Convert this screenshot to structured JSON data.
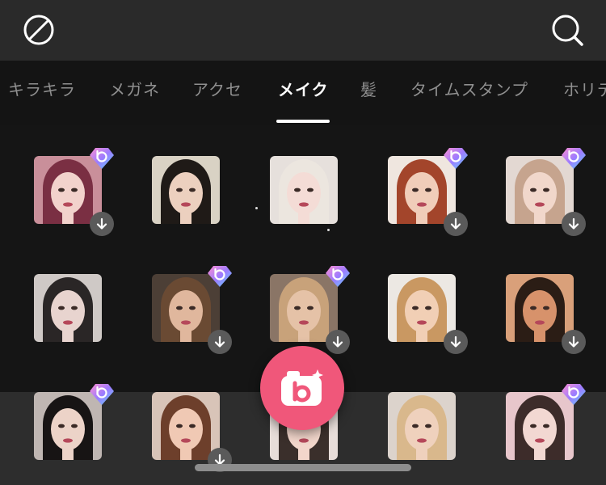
{
  "header": {
    "left_icon": "prohibit-icon",
    "right_icon": "search-icon"
  },
  "tabs": [
    {
      "label": "キラキラ"
    },
    {
      "label": "メガネ"
    },
    {
      "label": "アクセ"
    },
    {
      "label": "メイク",
      "active": true
    },
    {
      "label": "髪"
    },
    {
      "label": "タイムスタンプ"
    },
    {
      "label": "ホリデー"
    }
  ],
  "stickers": [
    {
      "row": 0,
      "col": 0,
      "premium": true,
      "download": true,
      "palette": {
        "bg": "#c98f9a",
        "hair": "#7a2f43",
        "skin": "#f2d2cc"
      }
    },
    {
      "row": 0,
      "col": 1,
      "premium": false,
      "download": false,
      "palette": {
        "bg": "#d9d2c4",
        "hair": "#1f1a17",
        "skin": "#ecd0bf"
      }
    },
    {
      "row": 0,
      "col": 2,
      "premium": false,
      "download": false,
      "palette": {
        "bg": "#e6e0dc",
        "hair": "#ece6df",
        "skin": "#f4dcd6"
      }
    },
    {
      "row": 0,
      "col": 3,
      "premium": true,
      "download": true,
      "palette": {
        "bg": "#efe6df",
        "hair": "#a3452b",
        "skin": "#f0cdb9"
      }
    },
    {
      "row": 0,
      "col": 4,
      "premium": true,
      "download": true,
      "palette": {
        "bg": "#e3d8d2",
        "hair": "#c6a48e",
        "skin": "#f1d7cb"
      }
    },
    {
      "row": 1,
      "col": 0,
      "premium": false,
      "download": false,
      "palette": {
        "bg": "#cfc9c6",
        "hair": "#2a2626",
        "skin": "#e8d4cf"
      }
    },
    {
      "row": 1,
      "col": 1,
      "premium": true,
      "download": true,
      "palette": {
        "bg": "#4c3f36",
        "hair": "#6a4a33",
        "skin": "#e0b79d"
      }
    },
    {
      "row": 1,
      "col": 2,
      "premium": true,
      "download": true,
      "palette": {
        "bg": "#8a7566",
        "hair": "#c8a27a",
        "skin": "#e5c2a7"
      }
    },
    {
      "row": 1,
      "col": 3,
      "premium": false,
      "download": true,
      "palette": {
        "bg": "#ece8e3",
        "hair": "#c99862",
        "skin": "#f1cfb5"
      }
    },
    {
      "row": 1,
      "col": 4,
      "premium": false,
      "download": true,
      "palette": {
        "bg": "#d9a07a",
        "hair": "#2b1d15",
        "skin": "#d7926b"
      }
    },
    {
      "row": 2,
      "col": 0,
      "premium": true,
      "download": false,
      "palette": {
        "bg": "#bfb6b2",
        "hair": "#171414",
        "skin": "#ecd3c8"
      }
    },
    {
      "row": 2,
      "col": 1,
      "premium": false,
      "download": true,
      "palette": {
        "bg": "#d8c4b8",
        "hair": "#6d3f2b",
        "skin": "#f0c9b4"
      }
    },
    {
      "row": 2,
      "col": 2,
      "premium": false,
      "download": false,
      "palette": {
        "bg": "#e7ddd9",
        "hair": "#3a2f2b",
        "skin": "#f2d6cb"
      }
    },
    {
      "row": 2,
      "col": 3,
      "premium": false,
      "download": false,
      "palette": {
        "bg": "#dcd3cc",
        "hair": "#d9b88c",
        "skin": "#efd1bd"
      }
    },
    {
      "row": 2,
      "col": 4,
      "premium": true,
      "download": false,
      "palette": {
        "bg": "#e7c6cb",
        "hair": "#3d2c2a",
        "skin": "#f2d8d2"
      }
    }
  ],
  "colors": {
    "accent": "#f0577a",
    "badge_gradient": [
      "#ff8fd1",
      "#9d7bff",
      "#5fd4ff"
    ],
    "download_bg": "#5a5a5a"
  },
  "camera_button": {
    "icon": "camera-icon"
  }
}
